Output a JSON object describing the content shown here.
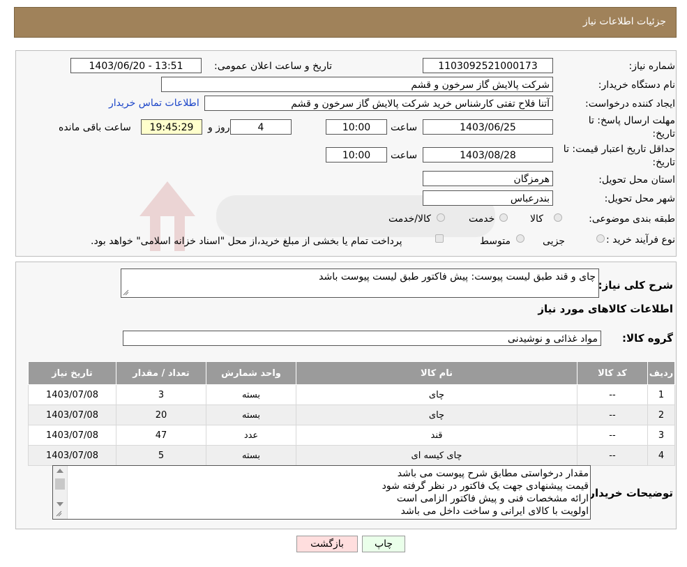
{
  "header": {
    "title": "جزئیات اطلاعات نیاز"
  },
  "details": {
    "need_number_label": "شماره نیاز:",
    "need_number": "1103092521000173",
    "announce_label": "تاریخ و ساعت اعلان عمومی:",
    "announce_value": "1403/06/20 - 13:51",
    "buyer_org_label": "نام دستگاه خریدار:",
    "buyer_org": "شرکت پالایش گاز سرخون و قشم",
    "creator_label": "ایجاد کننده درخواست:",
    "creator": "آتنا فلاح تفتی کارشناس خرید شرکت پالایش گاز سرخون و قشم",
    "contact_link": "اطلاعات تماس خریدار",
    "deadline_label_1": "مهلت ارسال پاسخ: تا",
    "deadline_label_2": "تاریخ:",
    "deadline_date": "1403/06/25",
    "time_word": "ساعت",
    "deadline_time": "10:00",
    "days_value": "4",
    "days_word": "روز و",
    "remaining_time": "19:45:29",
    "remaining_word": "ساعت باقی مانده",
    "validity_label_1": "حداقل تاریخ اعتبار قیمت: تا",
    "validity_label_2": "تاریخ:",
    "validity_date": "1403/08/28",
    "validity_time": "10:00",
    "province_label": "استان محل تحویل:",
    "province": "هرمزگان",
    "city_label": "شهر محل تحویل:",
    "city": "بندرعباس",
    "category_label": "طبقه بندی موضوعی:",
    "category_options": [
      "کالا",
      "خدمت",
      "کالا/خدمت"
    ],
    "process_label": "نوع فرآیند خرید :",
    "process_options": [
      "جزیی",
      "متوسط"
    ],
    "payment_note": "پرداخت تمام یا بخشی از مبلغ خرید،از محل \"اسناد خزانه اسلامی\" خواهد بود."
  },
  "description": {
    "label": "شرح کلی نیاز:",
    "text": "چای و قند طبق لیست پیوست: پیش فاکتور طبق لیست پیوست باشد"
  },
  "goods": {
    "section_title": "اطلاعات کالاهای مورد نیاز",
    "group_label": "گروه کالا:",
    "group_value": "مواد غذائی و نوشیدنی",
    "columns": [
      "ردیف",
      "کد کالا",
      "نام کالا",
      "واحد شمارش",
      "تعداد / مقدار",
      "تاریخ نیاز"
    ],
    "rows": [
      [
        "1",
        "--",
        "چای",
        "بسته",
        "3",
        "1403/07/08"
      ],
      [
        "2",
        "--",
        "چای",
        "بسته",
        "20",
        "1403/07/08"
      ],
      [
        "3",
        "--",
        "قند",
        "عدد",
        "47",
        "1403/07/08"
      ],
      [
        "4",
        "--",
        "چای کیسه ای",
        "بسته",
        "5",
        "1403/07/08"
      ]
    ]
  },
  "buyer_notes": {
    "label": "توضیحات خریدار:",
    "lines": [
      "مقدار درخواستی مطابق شرح پیوست می باشد",
      "قیمت پیشنهادی جهت یک فاکتور در نظر گرفته شود",
      "ارائه مشخصات فنی و پیش فاکتور الزامی است",
      "اولویت با کالای ایرانی و ساخت داخل می باشد"
    ]
  },
  "buttons": {
    "print": "چاپ",
    "back": "بازگشت"
  },
  "colors": {
    "header_bg": "#a0825a",
    "table_header_bg": "#9b9b9b",
    "link": "#1a44c8",
    "back_button_bg": "#ffdede",
    "print_button_bg": "#eaffea",
    "remaining_bg": "#ffffcc"
  }
}
